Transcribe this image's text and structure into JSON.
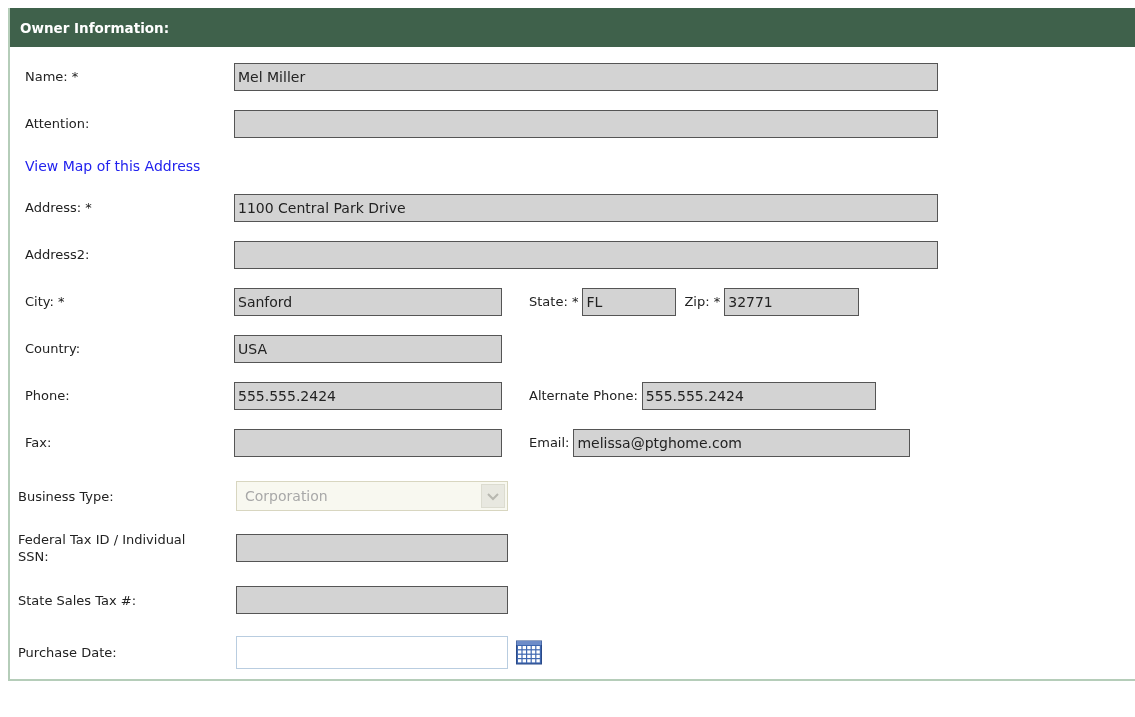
{
  "section": {
    "title": "Owner Information:"
  },
  "contact_rows": [
    {
      "kind": "full",
      "fields": [
        {
          "label": "Name: *",
          "value": "Mel Miller"
        }
      ]
    },
    {
      "kind": "full",
      "fields": [
        {
          "label": "Attention:"
        }
      ]
    },
    {
      "kind": "link",
      "link": "View Map of this Address"
    },
    {
      "kind": "full",
      "fields": [
        {
          "label": "Address: *",
          "value": "1100 Central Park Drive"
        }
      ]
    },
    {
      "kind": "full",
      "fields": [
        {
          "label": "Address2:"
        }
      ]
    },
    {
      "kind": "triple",
      "fields": [
        {
          "label": "City: *",
          "value": "Sanford"
        },
        {
          "label": "State: *",
          "value": "FL"
        },
        {
          "label": "Zip: *",
          "value": "32771"
        }
      ]
    },
    {
      "kind": "half",
      "fields": [
        {
          "label": "Country:",
          "value": "USA"
        }
      ]
    },
    {
      "kind": "double",
      "fields": [
        {
          "label": "Phone:",
          "value": "555.555.2424"
        },
        {
          "label": "Alternate Phone:",
          "value": "555.555.2424"
        }
      ]
    },
    {
      "kind": "double_wide",
      "fields": [
        {
          "label": "Fax:"
        },
        {
          "label": "Email:",
          "value": "melissa@ptghome.com"
        }
      ]
    }
  ],
  "business_rows": [
    {
      "kind": "select",
      "label": "Business Type:",
      "value": "Corporation",
      "disabled": true
    },
    {
      "kind": "text",
      "label": "Federal Tax ID / Individual SSN:"
    },
    {
      "kind": "text",
      "label": "State Sales Tax #:"
    },
    {
      "kind": "date",
      "label": "Purchase Date:"
    }
  ]
}
